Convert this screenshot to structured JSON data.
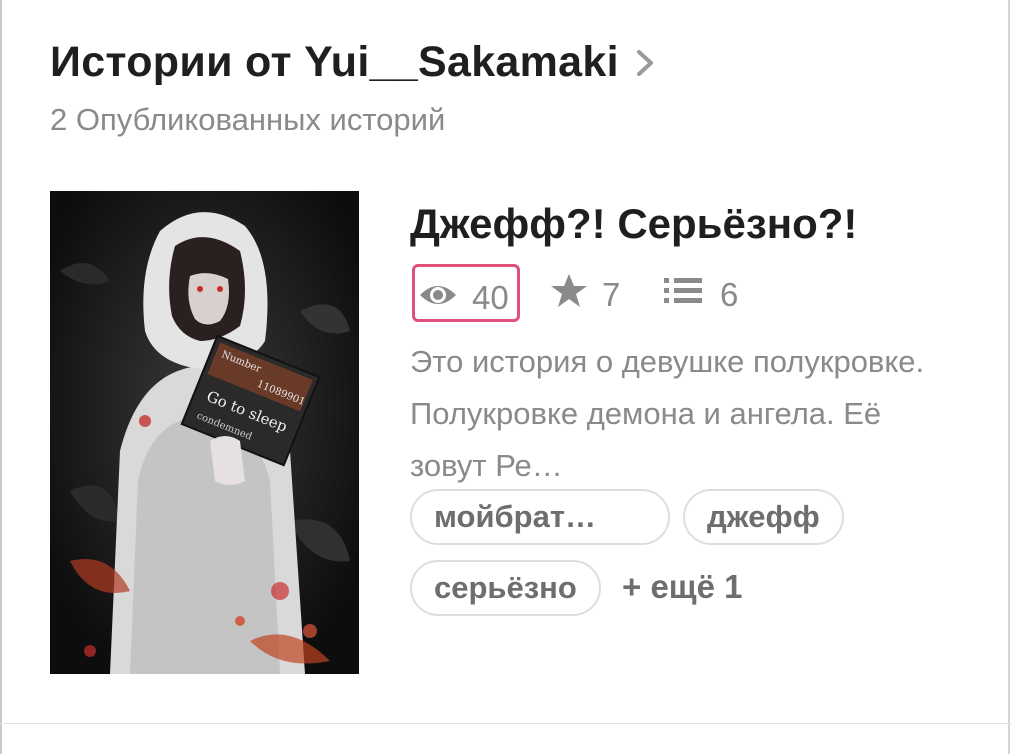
{
  "section": {
    "title": "Истории от Yui__Sakamaki",
    "subtitle": "2 Опубликованных историй"
  },
  "story": {
    "title": "Джефф?! Серьёзно?!",
    "stats": {
      "views": "40",
      "stars": "7",
      "parts": "6"
    },
    "description": "Это история о девушке полукровке. Полукровке демона и ангела. Её зовут Ре…",
    "tags": [
      "мойбрат…",
      "джефф",
      "серьёзно"
    ],
    "more_tags": "+ ещё 1",
    "cover_text": {
      "number_label": "Number",
      "number_value": "11089901",
      "card_text": "Go to sleep",
      "condemned": "condemned"
    }
  },
  "colors": {
    "highlight": "#e0507a",
    "muted": "#8a8a8a",
    "title": "#1f1f1f"
  },
  "icons": [
    "chevron-right-icon",
    "eye-icon",
    "star-icon",
    "list-icon"
  ]
}
